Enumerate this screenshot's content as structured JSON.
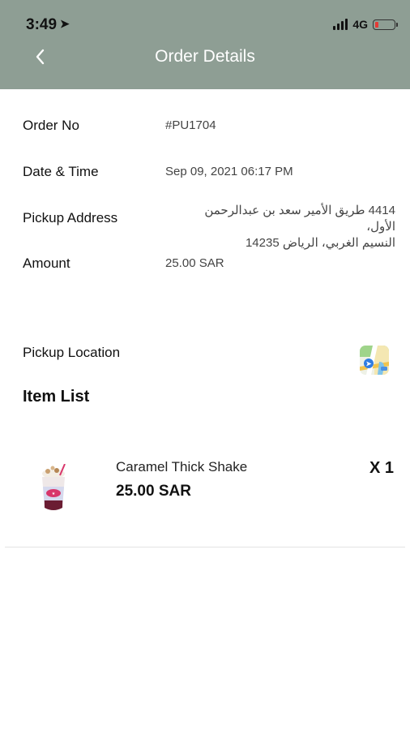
{
  "status_bar": {
    "time": "3:49",
    "network": "4G"
  },
  "header": {
    "title": "Order Details"
  },
  "details": {
    "order_no_label": "Order No",
    "order_no_value": "#PU1704",
    "datetime_label": "Date & Time",
    "datetime_value": "Sep 09, 2021 06:17 PM",
    "address_label": "Pickup Address",
    "address_line1": "4414 طريق الأمير سعد بن عبدالرحمن الأول،",
    "address_line2": "النسيم الغربي، الرياض 14235",
    "amount_label": "Amount",
    "amount_value": "25.00 SAR"
  },
  "pickup_location_label": "Pickup Location",
  "item_list_title": "Item List",
  "items": [
    {
      "name": "Caramel Thick Shake",
      "price": "25.00 SAR",
      "quantity": "X 1"
    }
  ],
  "colors": {
    "header_bg": "#8e9e94",
    "battery_low": "#e53935"
  }
}
